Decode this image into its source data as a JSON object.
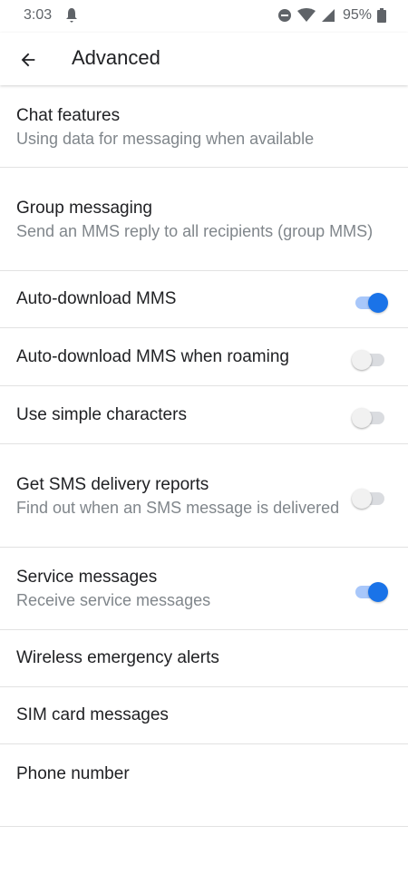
{
  "status_bar": {
    "time": "3:03",
    "battery_percent": "95%",
    "icons": [
      "notification-icon",
      "do-not-disturb-icon",
      "wifi-icon",
      "cellular-signal-icon",
      "battery-icon"
    ]
  },
  "app_bar": {
    "title": "Advanced",
    "back_icon": "arrow-back-icon"
  },
  "colors": {
    "accent": "#1a73e8",
    "accent_track": "#a8c7fa",
    "text_primary": "#202124",
    "text_secondary": "#80868b",
    "divider": "#e2e2e2"
  },
  "settings": [
    {
      "title": "Chat features",
      "subtitle": "Using data for messaging when available"
    },
    {
      "title": "Group messaging",
      "subtitle": "Send an MMS reply to all recipients (group MMS)"
    },
    {
      "title": "Auto-download MMS",
      "toggle": true
    },
    {
      "title": "Auto-download MMS when roaming",
      "toggle": false
    },
    {
      "title": "Use simple characters",
      "toggle": false
    },
    {
      "title": "Get SMS delivery reports",
      "subtitle": "Find out when an SMS message is delivered",
      "toggle": false
    },
    {
      "title": "Service messages",
      "subtitle": "Receive service messages",
      "toggle": true
    },
    {
      "title": "Wireless emergency alerts"
    },
    {
      "title": "SIM card messages"
    },
    {
      "title": "Phone number"
    }
  ]
}
